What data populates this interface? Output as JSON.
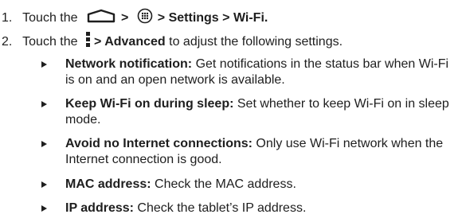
{
  "steps": [
    {
      "number": "1.",
      "pre": "Touch the",
      "icons": [
        "home-icon",
        "apps-icon"
      ],
      "sep1": ">",
      "sep2": ">",
      "path": "> Settings > Wi-Fi."
    },
    {
      "number": "2.",
      "pre": "Touch the",
      "icon": "menu-icon",
      "bold": "> Advanced",
      "post": "to adjust the following settings."
    }
  ],
  "settings": [
    {
      "title": "Network notification:",
      "description": "Get notifications in the status bar when Wi-Fi is on and an open network is available."
    },
    {
      "title": "Keep Wi-Fi on during sleep:",
      "description": "Set whether to keep Wi-Fi on in sleep mode."
    },
    {
      "title": "Avoid no Internet connections:",
      "description": "Only use Wi-Fi network when the Internet connection is good."
    },
    {
      "title": "MAC address:",
      "description": "Check the MAC address."
    },
    {
      "title": "IP address:",
      "description": "Check the tablet’s IP address."
    }
  ]
}
